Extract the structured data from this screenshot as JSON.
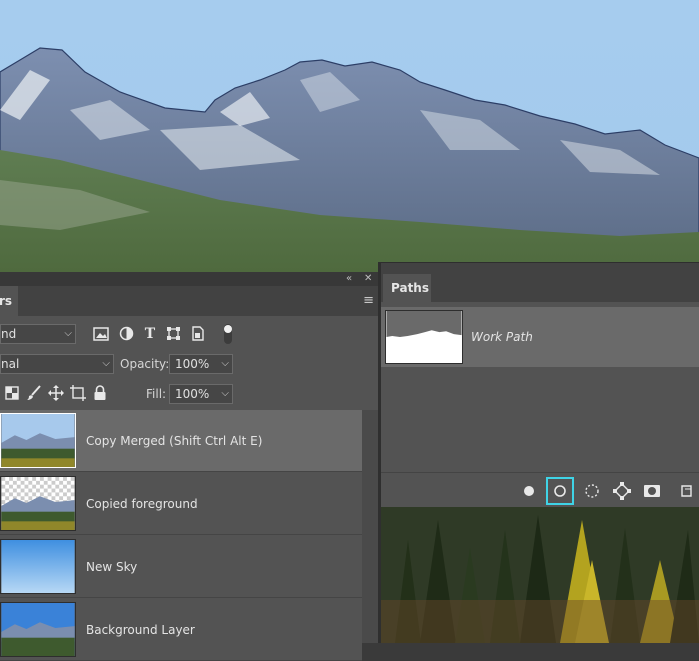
{
  "layers_panel": {
    "tab_partial": "rs",
    "collapse_glyph": "«",
    "close_glyph": "✕",
    "menu_glyph": "≡",
    "filter_kind": "nd",
    "blend_mode": "nal",
    "opacity_label": "Opacity:",
    "opacity_value": "100%",
    "fill_label": "Fill:",
    "fill_value": "100%",
    "layers": [
      {
        "name": "Copy Merged (Shift Ctrl Alt E)",
        "selected": true,
        "thumb": "full-scene"
      },
      {
        "name": "Copied foreground",
        "selected": false,
        "thumb": "foreground-transparent"
      },
      {
        "name": "New Sky",
        "selected": false,
        "thumb": "sky"
      },
      {
        "name": "Background Layer",
        "selected": false,
        "thumb": "full-scene"
      }
    ]
  },
  "paths_panel": {
    "tab_label": "Paths",
    "path_name": "Work Path",
    "footer_icons": [
      "fill-path-icon",
      "stroke-path-icon",
      "load-selection-icon",
      "make-work-path-icon",
      "add-mask-icon",
      "new-path-icon"
    ]
  },
  "colors": {
    "panel_bg": "#535353",
    "selected_row": "#6a6a6a",
    "active_button_outline": "#3fd3e6",
    "sky": "#a4c9ec"
  }
}
